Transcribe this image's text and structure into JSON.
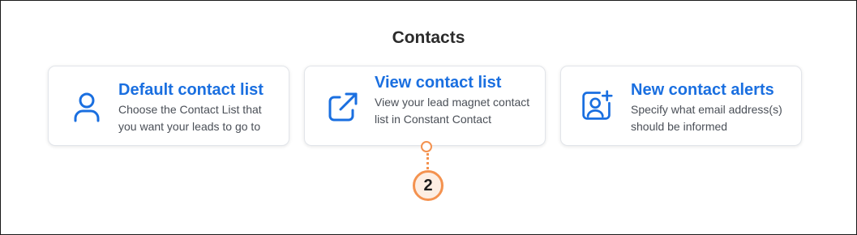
{
  "section": {
    "title": "Contacts"
  },
  "cards": [
    {
      "icon": "user-icon",
      "title": "Default contact list",
      "description": "Choose the Contact List that you want your leads to go to"
    },
    {
      "icon": "external-link-icon",
      "title": "View contact list",
      "description": "View your lead magnet contact list in Constant Contact"
    },
    {
      "icon": "add-contact-icon",
      "title": "New contact alerts",
      "description": "Specify what email address(s) should be informed"
    }
  ],
  "callout": {
    "number": "2",
    "color": "#f4924f"
  },
  "colors": {
    "accent": "#1a6fe0",
    "text": "#2b2b2b",
    "muted": "#4a4f57"
  }
}
